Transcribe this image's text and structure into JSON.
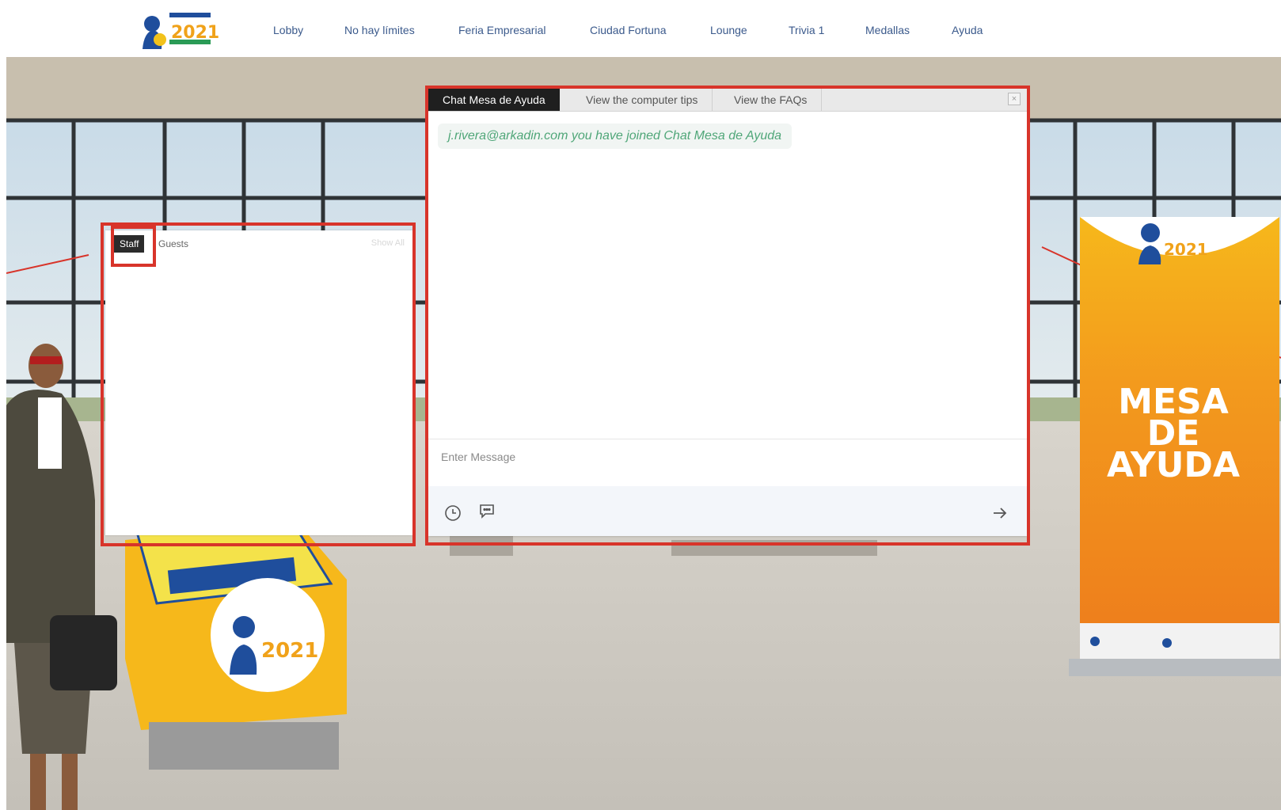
{
  "nav": {
    "logo_year": "2021",
    "items": [
      {
        "label": "Lobby"
      },
      {
        "label": "No hay límites"
      },
      {
        "label": "Feria Empresarial"
      },
      {
        "label": "Ciudad Fortuna"
      },
      {
        "label": "Lounge"
      },
      {
        "label": "Trivia 1"
      },
      {
        "label": "Medallas"
      },
      {
        "label": "Ayuda"
      }
    ]
  },
  "staff_panel": {
    "tabs": [
      {
        "label": "Staff",
        "active": true
      },
      {
        "label": "Guests",
        "active": false
      }
    ],
    "show_all": "Show All"
  },
  "chat": {
    "tabs": [
      {
        "label": "Chat Mesa de Ayuda",
        "active": true
      },
      {
        "label": "View the computer tips",
        "active": false
      },
      {
        "label": "View the FAQs",
        "active": false
      }
    ],
    "join_message": "j.rivera@arkadin.com you have joined Chat Mesa de Ayuda",
    "input_placeholder": "Enter Message",
    "icons": [
      "clock-icon",
      "chat-bubble-icon",
      "arrow-right-icon"
    ]
  },
  "banner": {
    "line1": "MESA",
    "line2": "DE",
    "line3": "AYUDA",
    "logo_year": "2021"
  },
  "kiosk": {
    "logo_year": "2021"
  },
  "colors": {
    "annotation": "#d8342a",
    "nav_text": "#3b5a8c",
    "join_text": "#4fa678",
    "banner_orange": "#f08a1c",
    "banner_yellow": "#f6b81b"
  }
}
